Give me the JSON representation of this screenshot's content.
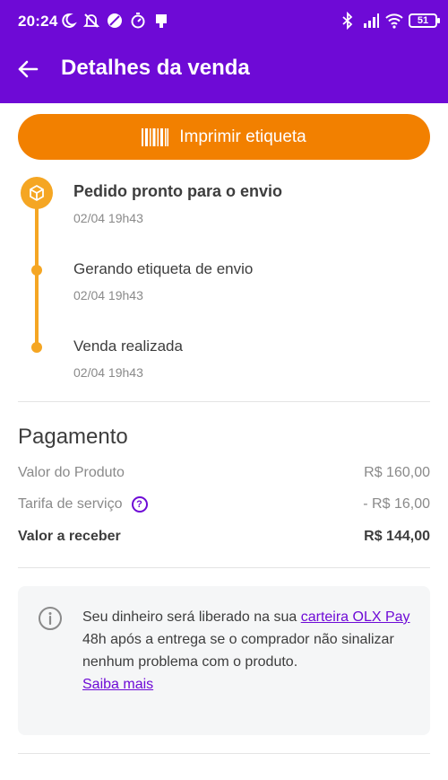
{
  "status_bar": {
    "time": "20:24",
    "battery": "51"
  },
  "header": {
    "title": "Detalhes da venda"
  },
  "actions": {
    "print_label": "Imprimir etiqueta"
  },
  "timeline": [
    {
      "title": "Pedido pronto para o envio",
      "date": "02/04 19h43"
    },
    {
      "title": "Gerando etiqueta de envio",
      "date": "02/04 19h43"
    },
    {
      "title": "Venda realizada",
      "date": "02/04 19h43"
    }
  ],
  "payment": {
    "title": "Pagamento",
    "rows": [
      {
        "label": "Valor do Produto",
        "value": "R$ 160,00"
      },
      {
        "label": "Tarifa de serviço",
        "value": "- R$ 16,00"
      },
      {
        "label": "Valor a receber",
        "value": "R$ 144,00"
      }
    ]
  },
  "info": {
    "text_before": "Seu dinheiro será liberado na sua ",
    "link": "carteira OLX Pay",
    "text_after": " 48h após a entrega se o comprador não sinalizar nenhum problema com o produto.",
    "more_link": "Saiba mais"
  },
  "colors": {
    "primary": "#6e0ad6",
    "accent": "#f28000",
    "timeline": "#f5a623"
  }
}
